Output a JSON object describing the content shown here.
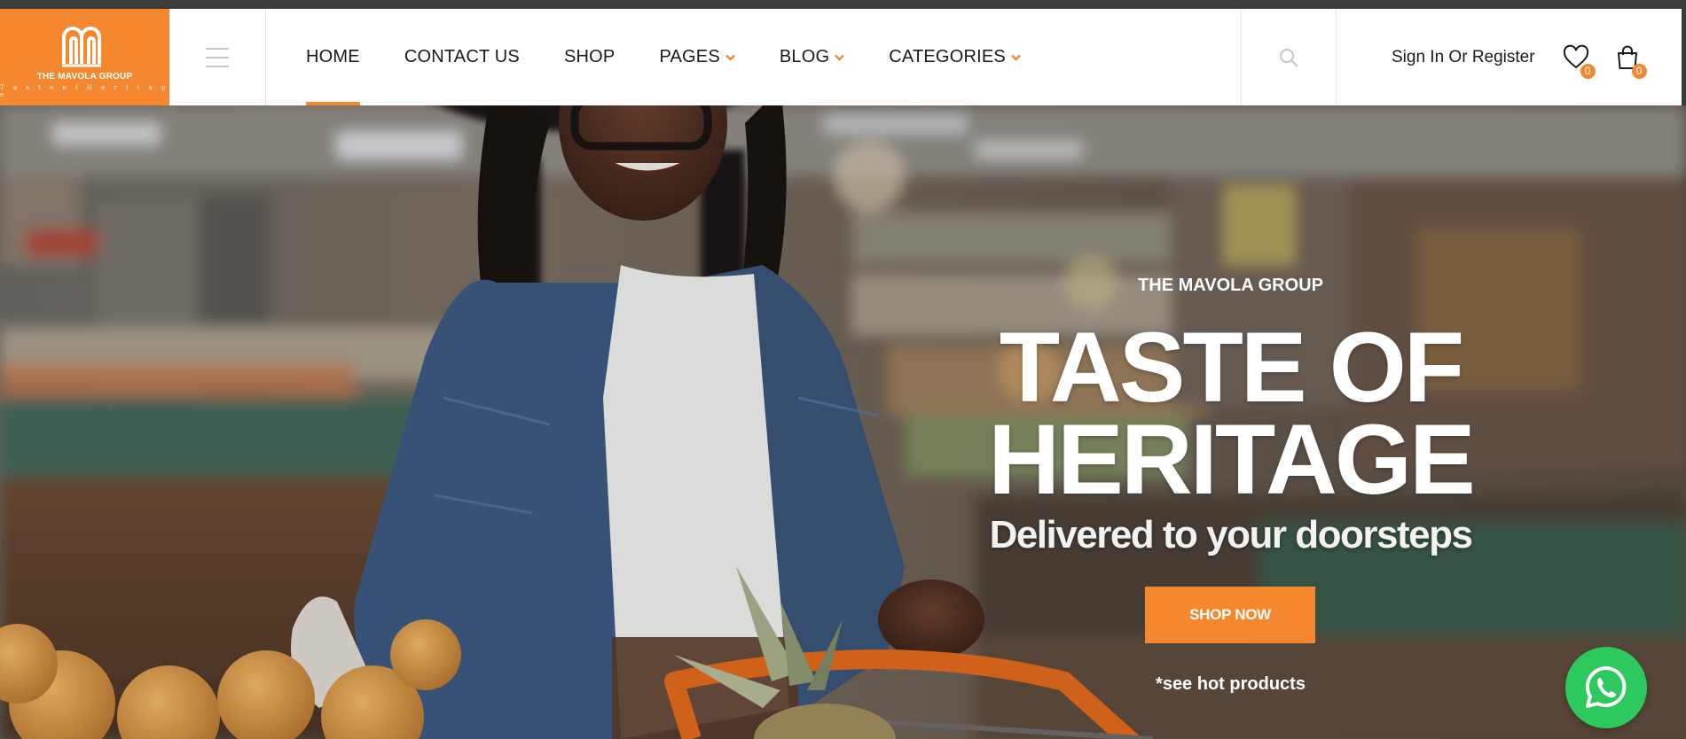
{
  "brand": {
    "name": "THE MAVOLA GROUP",
    "tagline": "T a s t e o f H e r i t a g e",
    "accent_color": "#f5882f"
  },
  "header": {
    "menu_icon": "hamburger-icon",
    "nav": [
      {
        "label": "HOME",
        "active": true,
        "dropdown": false
      },
      {
        "label": "CONTACT US",
        "active": false,
        "dropdown": false
      },
      {
        "label": "SHOP",
        "active": false,
        "dropdown": false
      },
      {
        "label": "PAGES",
        "active": false,
        "dropdown": true
      },
      {
        "label": "BLOG",
        "active": false,
        "dropdown": true
      },
      {
        "label": "CATEGORIES",
        "active": false,
        "dropdown": true
      }
    ],
    "dropdown_glyph": "⌄",
    "search_icon": "search-icon",
    "signin_label": "Sign In Or Register",
    "wishlist_count": "0",
    "cart_count": "0"
  },
  "hero": {
    "eyebrow": "THE MAVOLA GROUP",
    "headline_line1": "TASTE OF",
    "headline_line2": "HERITAGE",
    "subline": "Delivered to your doorsteps",
    "cta_label": "SHOP NOW",
    "note": "*see hot products"
  },
  "floating": {
    "whatsapp_icon": "whatsapp-icon",
    "whatsapp_color": "#2ec95c"
  }
}
